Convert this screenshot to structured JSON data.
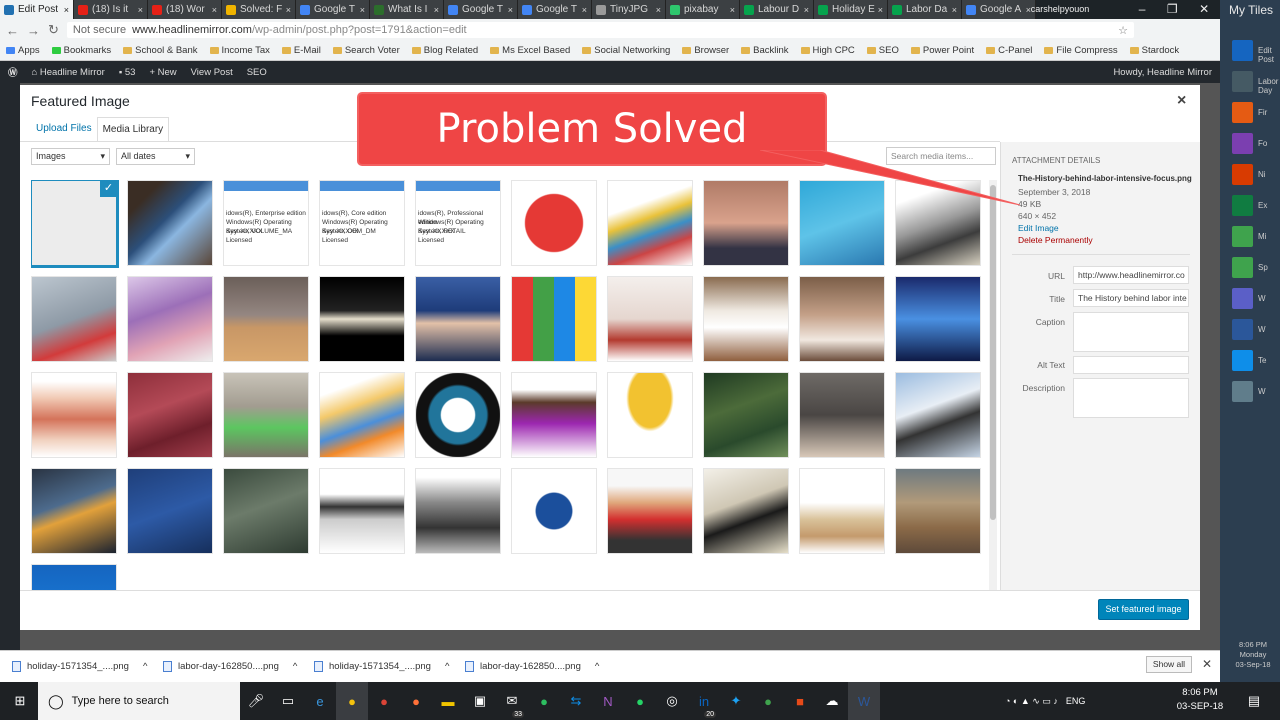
{
  "browser": {
    "tabs": [
      {
        "label": "Edit Post",
        "color": "#2271b1",
        "active": true
      },
      {
        "label": "(18) Is it",
        "color": "#e62117"
      },
      {
        "label": "(18) Wor",
        "color": "#e62117"
      },
      {
        "label": "Solved: F",
        "color": "#f0b400"
      },
      {
        "label": "Google T",
        "color": "#4285f4"
      },
      {
        "label": "What Is I",
        "color": "#2c6e2c"
      },
      {
        "label": "Google T",
        "color": "#4285f4"
      },
      {
        "label": "Google T",
        "color": "#4285f4"
      },
      {
        "label": "TinyJPG",
        "color": "#9a9a9a"
      },
      {
        "label": "pixabay",
        "color": "#2ec66d"
      },
      {
        "label": "Labour D",
        "color": "#06a34d"
      },
      {
        "label": "Holiday E",
        "color": "#06a34d"
      },
      {
        "label": "Labor Da",
        "color": "#06a34d"
      },
      {
        "label": "Google A",
        "color": "#4285f4"
      }
    ],
    "profile": "carshelpyouon",
    "window_controls": [
      "–",
      "❐",
      "✕"
    ],
    "url_not_secure": "Not secure",
    "url_host": "www.headlinemirror.com",
    "url_path": "/wp-admin/post.php?post=1791&action=edit"
  },
  "bookmarks": [
    "Apps",
    "Bookmarks",
    "School & Bank",
    "Income Tax",
    "E-Mail",
    "Search Voter",
    "Blog Related",
    "Ms Excel Based",
    "Social Networking",
    "Browser",
    "Backlink",
    "High CPC",
    "SEO",
    "Power Point",
    "C-Panel",
    "File Compress",
    "Stardock"
  ],
  "wp_admin_bar": {
    "site_name": "Headline Mirror",
    "comments": "53",
    "new": "New",
    "view_post": "View Post",
    "seo": "SEO",
    "howdy": "Howdy, Headline Mirror"
  },
  "modal": {
    "title": "Featured Image",
    "close": "×",
    "tabs": [
      "Upload Files",
      "Media Library"
    ],
    "filter_type": "Images",
    "filter_date": "All dates",
    "search_placeholder": "Search media items...",
    "set_button": "Set featured image"
  },
  "callout": "Problem Solved",
  "thumbs": [
    {
      "bg": "#ececec",
      "selected": true
    },
    {
      "bg": "linear-gradient(135deg,#3a2d24 20%,#2c4f7a 45%,#8bb6e0 60%,#5a4638)"
    },
    {
      "bg": "#ffffff",
      "lines": [
        "idows(R), Enterprise edition",
        "Windows(R) Operating System, VOLUME_MA",
        "Key: XXXXX",
        "Licensed"
      ]
    },
    {
      "bg": "#ffffff",
      "lines": [
        "idows(R), Core edition",
        "Windows(R) Operating System, OEM_DM",
        "Key: XXXXX",
        "Licensed"
      ]
    },
    {
      "bg": "#ffffff",
      "lines": [
        "idows(R), Professional edition",
        "Windows(R) Operating System, RETAIL",
        "Key: XXXXX",
        "Licensed"
      ]
    },
    {
      "bg": "radial-gradient(circle,#e53935 48%,#fff 50%)"
    },
    {
      "bg": "linear-gradient(160deg,#fff 30%,#e9c23a 45%,#3b8fc7 60%,#c44 75%,#fff)"
    },
    {
      "bg": "linear-gradient(180deg,#b07b67,#d9a28c 50%,#334 80%)"
    },
    {
      "bg": "linear-gradient(160deg,#2fa8d8,#5ec3e8 50%,#2a78b0)"
    },
    {
      "bg": "linear-gradient(160deg,#fff 20%,#999 50%,#3c3c3c 70%,#d6d0c0)"
    },
    {
      "bg": "linear-gradient(160deg,#bcc6cf,#8e9aa6 50%,#d23b3b 75%,#ccc)"
    },
    {
      "bg": "linear-gradient(160deg,#dcc7e8,#9c6fb8 40%,#e1a3b5 70%,#eee)"
    },
    {
      "bg": "linear-gradient(180deg,#6b5f59,#948681 45%,#c89766 60%,#d9a76e)"
    },
    {
      "bg": "linear-gradient(180deg,#000,#222 40%,#e6dfcc 50%,#000 70%)"
    },
    {
      "bg": "linear-gradient(180deg,#3a5fa5,#1e3c7a 40%,#e3c1a8 55%,#1d2c50)"
    },
    {
      "bg": "linear-gradient(90deg,#e53935 25%,#43a047 25% 50%,#1e88e5 50% 75%,#fdd835 75%)"
    },
    {
      "bg": "linear-gradient(180deg,#f4efec,#e5d6cf 50%,#b33a2f 75%,#fff)"
    },
    {
      "bg": "linear-gradient(180deg,#8a6b4f,#efe9e1 40%,#fff 60%,#8f5f3e)"
    },
    {
      "bg": "linear-gradient(180deg,#7b5e48,#c4a088 45%,#f1e8e0 75%,#6b4c3a)"
    },
    {
      "bg": "linear-gradient(180deg,#1a2a6c,#4a90e2 50%,#0e1a46)"
    },
    {
      "bg": "linear-gradient(180deg,#fff 10%,#f1c9b4 30%,#d4735a 55%,#f1d2c0 80%,#fff)"
    },
    {
      "bg": "linear-gradient(160deg,#8e2f3b,#b44a57 40%,#6e1f2b 70%,#a13d4b)"
    },
    {
      "bg": "linear-gradient(180deg,#c8c3b8,#a29c90 40%,#5cc660 65%,#7a7468)"
    },
    {
      "bg": "linear-gradient(160deg,#fff 20%,#f4c96a 40%,#4b8fda 60%,#f28a2a 75%,#fff)"
    },
    {
      "bg": "radial-gradient(circle,#fff 28%,#21759b 30% 48%,#111 52% 70%,#fff 72%)"
    },
    {
      "bg": "linear-gradient(180deg,#fff 20%,#5b3a2a 35%,#9c27b0 60%,#fff)"
    },
    {
      "bg": "radial-gradient(ellipse at 50% 30%,#f2c230 35%,#fff 40%)"
    },
    {
      "bg": "linear-gradient(160deg,#1f3a22,#4c6b3a 40%,#2a4a2c 70%,#71905b)"
    },
    {
      "bg": "linear-gradient(180deg,#6e6a66,#4a4644 50%,#d8c8b8)"
    },
    {
      "bg": "linear-gradient(160deg,#9bbce0,#e8eef5 40%,#333 60%,#c5d4e5)"
    },
    {
      "bg": "linear-gradient(160deg,#2a3443,#4d6b8d 40%,#e2a13b 55%,#1b2230)"
    },
    {
      "bg": "linear-gradient(160deg,#1f3f7a,#2d5aa6 50%,#162f5c)"
    },
    {
      "bg": "linear-gradient(160deg,#3b4b3e,#6c7b6a 45%,#2e3b31)"
    },
    {
      "bg": "linear-gradient(180deg,#fff 30%,#333 45%,#ccc 60%,#fff)"
    },
    {
      "bg": "linear-gradient(180deg,#fff 10%,#888 40%,#333 70%,#bbb)"
    },
    {
      "bg": "radial-gradient(circle,#1b4f9c 30%,#fff 32%)"
    },
    {
      "bg": "linear-gradient(180deg,#f7f7f7 20%,#e0a87c 40%,#d32f2f 60%,#333 85%)"
    },
    {
      "bg": "linear-gradient(160deg,#f3f0e8,#cfc7b4 40%,#1a1a1a 60%,#e6dfc9)"
    },
    {
      "bg": "linear-gradient(180deg,#fff 40%,#d9c29a 60%,#c49a6c 80%,#fff)"
    },
    {
      "bg": "linear-gradient(180deg,#6e7a80,#b19a7a 40%,#8b6a48 70%,#5e4a3a)"
    },
    {
      "bg": "linear-gradient(180deg,#1565c0,#1976d2 50%,#e53935)"
    }
  ],
  "attachment": {
    "heading": "ATTACHMENT DETAILS",
    "filename": "The-History-behind-labor-intensive-focus.png",
    "date": "September 3, 2018",
    "size": "49 KB",
    "dimensions": "640 × 452",
    "edit": "Edit Image",
    "delete": "Delete Permanently",
    "url_label": "URL",
    "url_value": "http://www.headlinemirror.co",
    "title_label": "Title",
    "title_value": "The History behind labor inte",
    "caption_label": "Caption",
    "alt_label": "Alt Text",
    "desc_label": "Description"
  },
  "downloads": {
    "items": [
      "holiday-1571354_....png",
      "labor-day-162850....png",
      "holiday-1571354_....png",
      "labor-day-162850....png"
    ],
    "show_all": "Show all",
    "close": "✕"
  },
  "taskbar": {
    "search": "Type here to search",
    "mail_badge": "33",
    "linkedin_badge": "20",
    "lang": "ENG",
    "time": "8:06 PM",
    "date": "03-SEP-18"
  },
  "side_tiles": {
    "header": "My Tiles",
    "labels": [
      "Edit Post",
      "Labor Day",
      "Fir",
      "Fo",
      "Ni",
      "Ex",
      "Mi",
      "Sp",
      "W",
      "W",
      "Te",
      "W"
    ],
    "clock": [
      "8:06 PM",
      "Monday",
      "03-Sep-18"
    ]
  }
}
